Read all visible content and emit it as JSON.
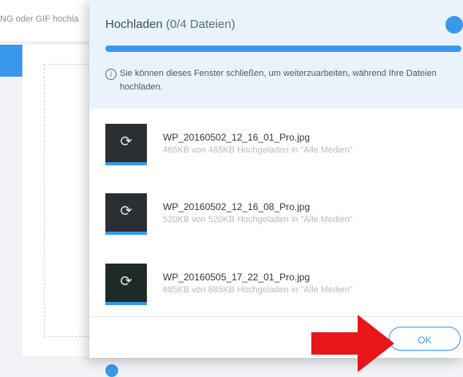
{
  "background": {
    "hint_text": "NG oder GIF hochla"
  },
  "dialog": {
    "title": "Hochladen",
    "count": "(0/4 Dateien)",
    "progress": 1.0,
    "info_text": "Sie können dieses Fenster schließen, um weiterzuarbeiten, während Ihre Dateien hochladen.",
    "files": [
      {
        "name": "WP_20160502_12_16_01_Pro.jpg",
        "status": "465KB von 465KB Hochgeladen in \"Alle Medien\""
      },
      {
        "name": "WP_20160502_12_16_08_Pro.jpg",
        "status": "520KB von 520KB Hochgeladen in \"Alle Medien\""
      },
      {
        "name": "WP_20160505_17_22_01_Pro.jpg",
        "status": "685KB von 685KB Hochgeladen in \"Alle Medien\""
      }
    ],
    "ok_label": "OK"
  },
  "colors": {
    "accent": "#3899ec",
    "header_bg": "#eaf3fc",
    "annotation_arrow": "#e8151b"
  },
  "icons": {
    "info": "info-icon",
    "sync": "sync-icon",
    "close": "close-icon"
  }
}
